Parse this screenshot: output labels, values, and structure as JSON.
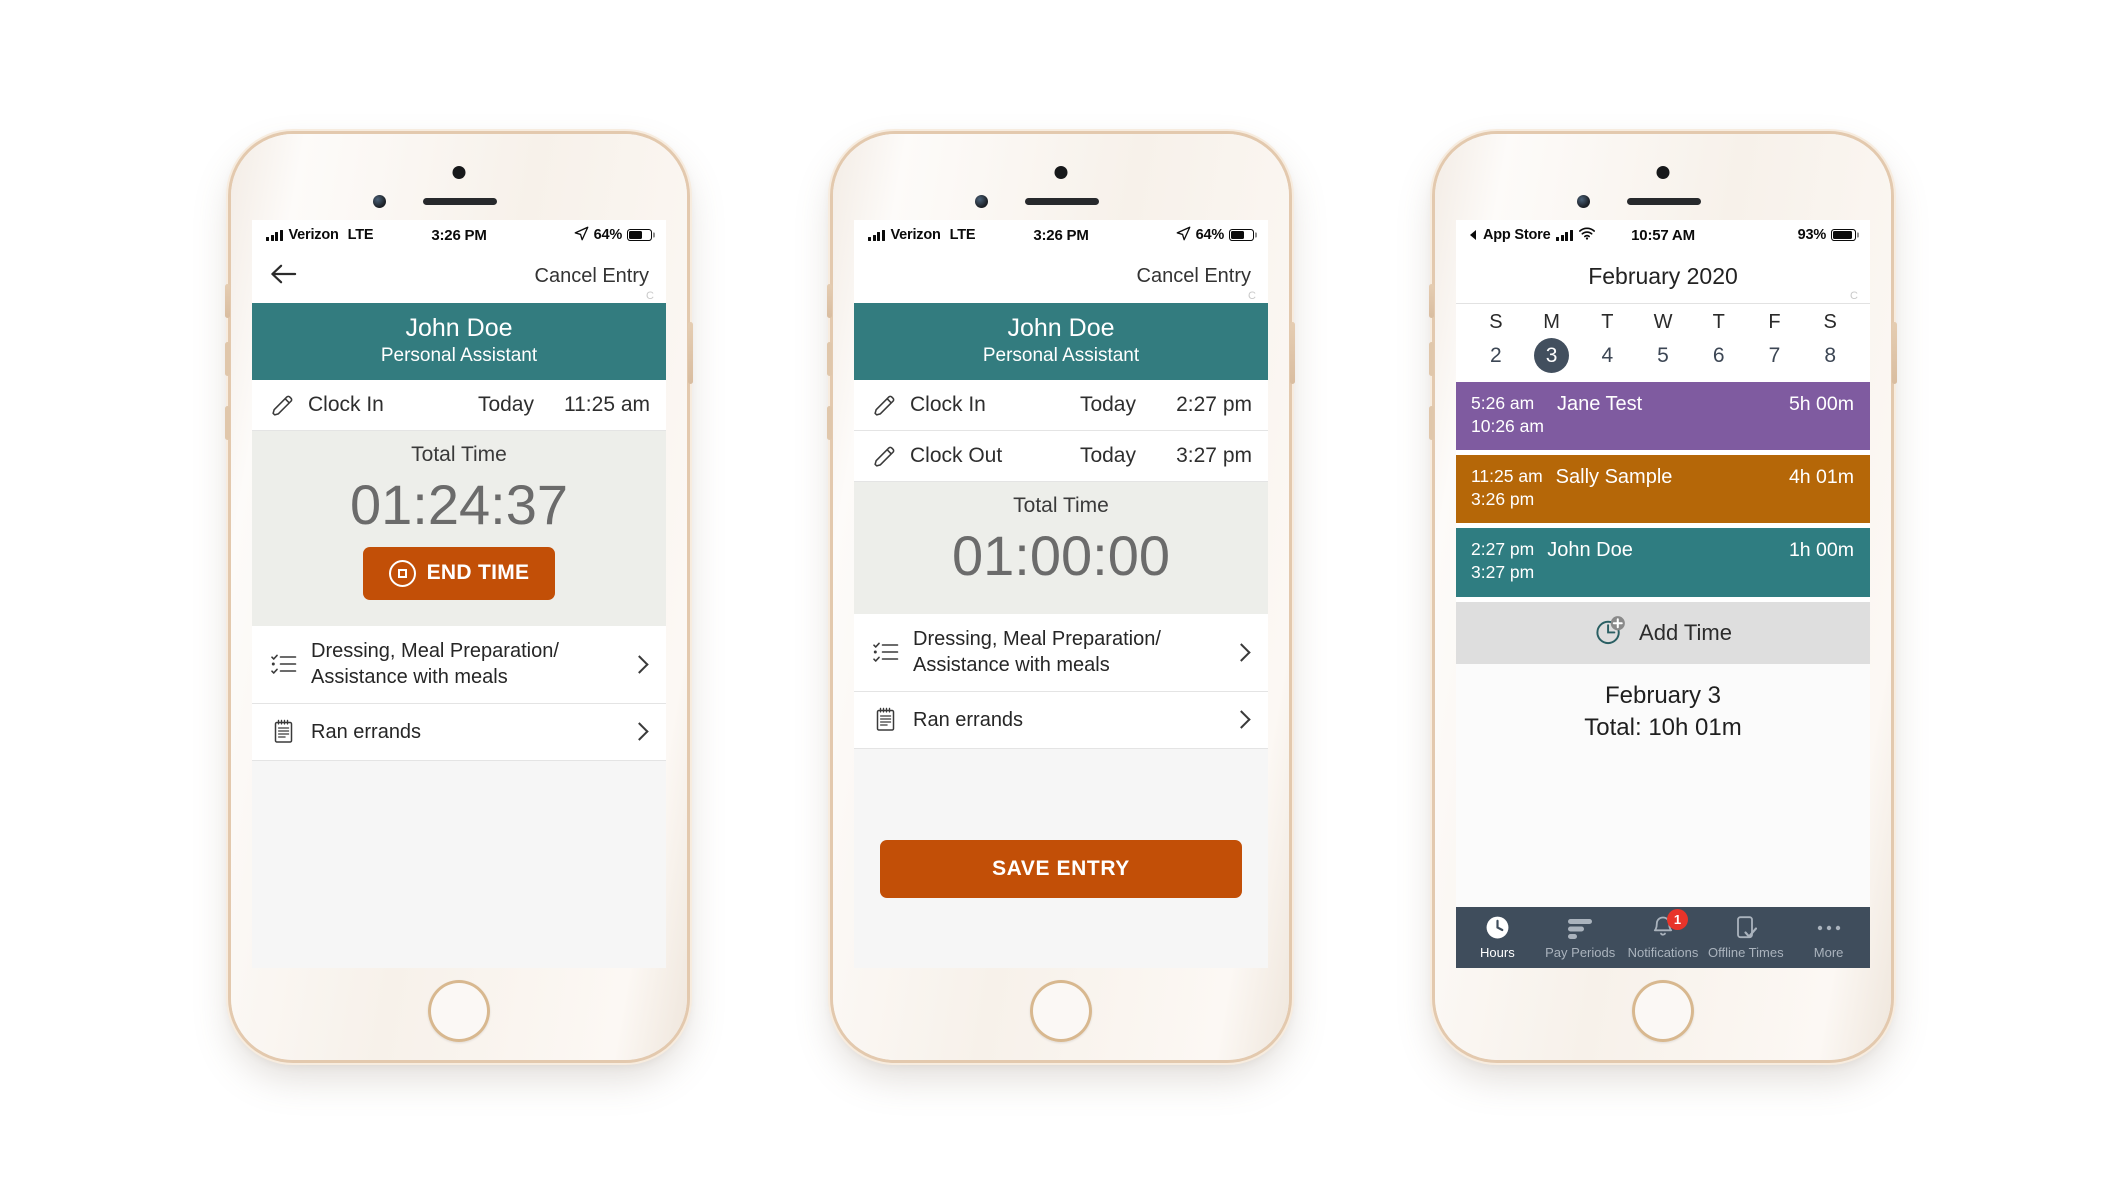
{
  "phones": [
    {
      "id": "clock-in-running",
      "status_bar": {
        "carrier": "Verizon",
        "network": "LTE",
        "time": "3:26 PM",
        "battery_pct": "64%",
        "location_icon": "location-arrow-icon",
        "signal_icon": "signal-bars-icon"
      },
      "nav": {
        "back_icon": "back-arrow-icon",
        "right_action": "Cancel Entry",
        "corner_mark": "C"
      },
      "person": {
        "name": "John Doe",
        "role": "Personal Assistant"
      },
      "clock_rows": [
        {
          "icon": "pencil-icon",
          "label": "Clock In",
          "day": "Today",
          "time": "11:25 am"
        }
      ],
      "total": {
        "label": "Total Time",
        "value": "01:24:37"
      },
      "primary_button": {
        "label": "END TIME",
        "icon": "stop-icon",
        "color": "#c24f07"
      },
      "tasks": [
        {
          "icon": "checklist-icon",
          "text": "Dressing, Meal Preparation/\nAssistance with meals",
          "chevron": "chevron-right-icon"
        },
        {
          "icon": "notepad-icon",
          "text": "Ran errands",
          "chevron": "chevron-right-icon"
        }
      ]
    },
    {
      "id": "clock-out-saved",
      "status_bar": {
        "carrier": "Verizon",
        "network": "LTE",
        "time": "3:26 PM",
        "battery_pct": "64%",
        "location_icon": "location-arrow-icon",
        "signal_icon": "signal-bars-icon"
      },
      "nav": {
        "back_icon": "",
        "right_action": "Cancel Entry",
        "corner_mark": "C"
      },
      "person": {
        "name": "John Doe",
        "role": "Personal Assistant"
      },
      "clock_rows": [
        {
          "icon": "pencil-icon",
          "label": "Clock In",
          "day": "Today",
          "time": "2:27 pm"
        },
        {
          "icon": "pencil-icon",
          "label": "Clock Out",
          "day": "Today",
          "time": "3:27 pm"
        }
      ],
      "total": {
        "label": "Total Time",
        "value": "01:00:00"
      },
      "tasks": [
        {
          "icon": "checklist-icon",
          "text": "Dressing, Meal Preparation/\nAssistance with meals",
          "chevron": "chevron-right-icon"
        },
        {
          "icon": "notepad-icon",
          "text": "Ran errands",
          "chevron": "chevron-right-icon"
        }
      ],
      "save_button": {
        "label": "SAVE ENTRY",
        "color": "#c24f07"
      }
    },
    {
      "id": "calendar-day",
      "status_bar": {
        "back_app": "App Store",
        "time": "10:57 AM",
        "battery_pct": "93%",
        "wifi_icon": "wifi-icon",
        "signal_icon": "signal-bars-icon"
      },
      "nav": {
        "title": "February 2020",
        "corner_mark": "C"
      },
      "week": {
        "weekday_labels": [
          "S",
          "M",
          "T",
          "W",
          "T",
          "F",
          "S"
        ],
        "day_numbers": [
          "2",
          "3",
          "4",
          "5",
          "6",
          "7",
          "8"
        ],
        "selected_index": 1
      },
      "events": [
        {
          "start": "5:26 am",
          "end": "10:26 am",
          "name": "Jane Test",
          "duration": "5h 00m",
          "color": "#7f5ba0"
        },
        {
          "start": "11:25 am",
          "end": "3:26 pm",
          "name": "Sally Sample",
          "duration": "4h 01m",
          "color": "#b56708"
        },
        {
          "start": "2:27 pm",
          "end": "3:27 pm",
          "name": "John Doe",
          "duration": "1h 00m",
          "color": "#2f7d81"
        }
      ],
      "add_time": {
        "label": "Add Time",
        "icon": "clock-plus-icon"
      },
      "day_total": {
        "date": "February 3",
        "total": "Total: 10h 01m"
      },
      "tabs": [
        {
          "label": "Hours",
          "icon": "clock-icon",
          "active": true,
          "badge": ""
        },
        {
          "label": "Pay Periods",
          "icon": "bar-chart-icon",
          "active": false,
          "badge": ""
        },
        {
          "label": "Notifications",
          "icon": "bell-icon",
          "active": false,
          "badge": "1"
        },
        {
          "label": "Offline Times",
          "icon": "phone-check-icon",
          "active": false,
          "badge": ""
        },
        {
          "label": "More",
          "icon": "ellipsis-icon",
          "active": false,
          "badge": ""
        }
      ]
    }
  ],
  "colors": {
    "teal": "#337c7f",
    "orange": "#c24f07",
    "purple": "#7f5ba0",
    "amber": "#b56708",
    "tabbar": "#3f4d5c",
    "selected_day": "#424f5e",
    "badge_red": "#e8342a"
  }
}
